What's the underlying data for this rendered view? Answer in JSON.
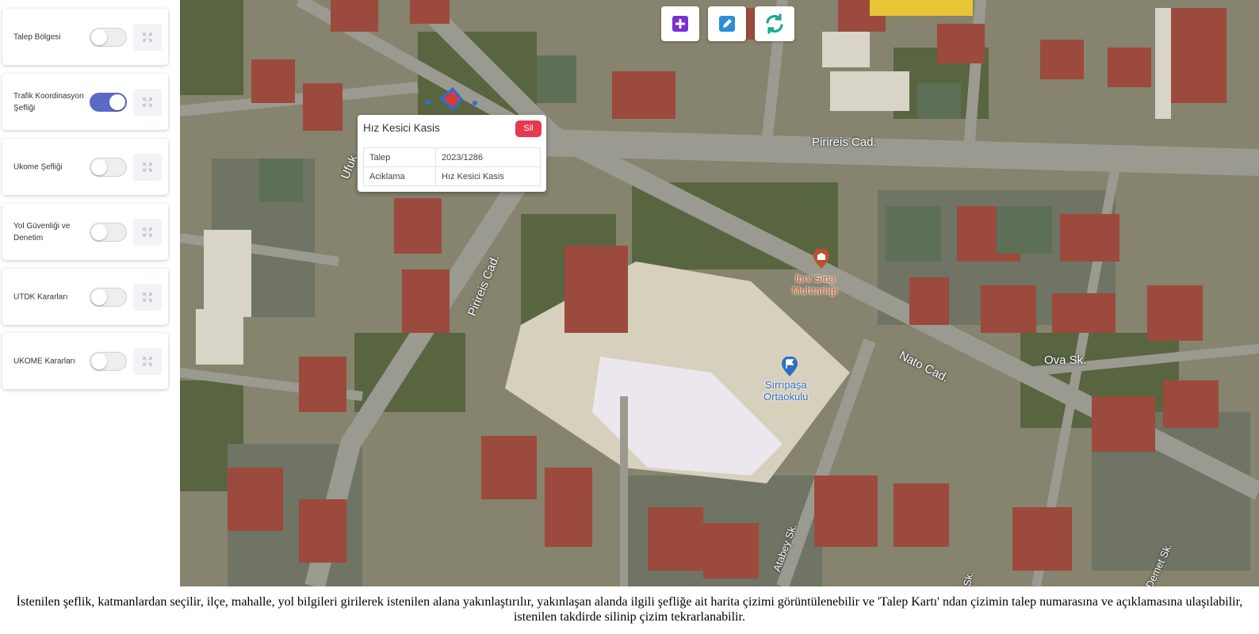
{
  "layers": [
    {
      "label": "Talep Bölgesi",
      "enabled": false
    },
    {
      "label": "Trafik Koordinasyon Şefliği",
      "enabled": true
    },
    {
      "label": "Ukome Şefliği",
      "enabled": false
    },
    {
      "label": "Yol Güvenliği ve Denetim",
      "enabled": false
    },
    {
      "label": "UTDK Kararları",
      "enabled": false
    },
    {
      "label": "UKOME Kararları",
      "enabled": false
    }
  ],
  "toolbar": {
    "add_icon": "plus-square-icon",
    "edit_icon": "edit-pencil-icon",
    "refresh_icon": "refresh-icon",
    "add_color": "#7b2fd0",
    "edit_color": "#2a8fd6",
    "refresh_color": "#1aa98c"
  },
  "popup": {
    "title": "Hız Kesici Kasis",
    "delete_label": "Sil",
    "rows": [
      {
        "key": "Talep",
        "value": "2023/1286"
      },
      {
        "key": "Aciklama",
        "value": "Hız Kesici Kasis"
      }
    ]
  },
  "map": {
    "streets": {
      "pirireis_top": "Pirireis Cad.",
      "pirireis_diag": "Pirireis Cad.",
      "nato": "Nato Cad.",
      "ova": "Ova Sk.",
      "atabey": "Atabey Sk.",
      "ufuk": "Ufuk",
      "demet": "Demet Sk.",
      "frag_sk": "Sk."
    },
    "poi": [
      {
        "name": "İbni Sina\nMuhtarlığı",
        "color": "#b8532e",
        "icon": "building-pin-icon"
      },
      {
        "name": "Sırrıpaşa\nOrtaokulu",
        "color": "#2d6fc1",
        "icon": "flag-pin-icon"
      }
    ]
  },
  "caption": "İstenilen şeflik, katmanlardan seçilir, ilçe, mahalle, yol bilgileri girilerek istenilen alana yakınlaştırılır, yakınlaşan alanda ilgili şefliğe ait harita çizimi görüntülenebilir ve 'Talep Kartı' ndan çizimin talep numarasına ve açıklamasına ulaşılabilir, istenilen takdirde silinip çizim tekrarlanabilir."
}
